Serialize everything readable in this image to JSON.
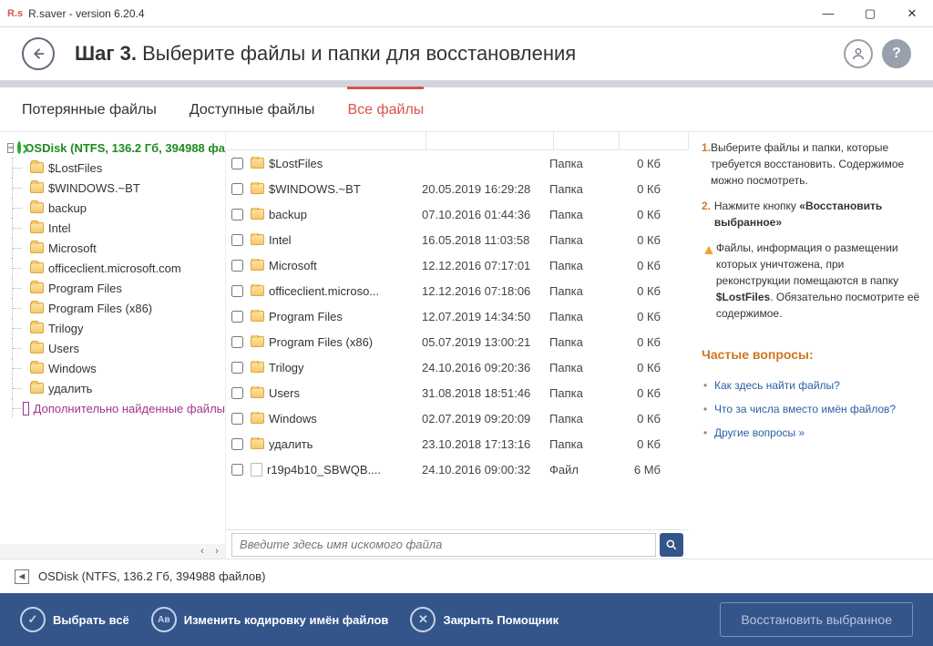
{
  "titlebar": {
    "app_icon": "R.s",
    "title": "R.saver - version 6.20.4"
  },
  "header": {
    "step_prefix": "Шаг 3.",
    "step_text": "Выберите файлы и папки для восстановления"
  },
  "tabs": {
    "lost": "Потерянные файлы",
    "available": "Доступные файлы",
    "all": "Все файлы"
  },
  "tree": {
    "root": "OSDisk (NTFS, 136.2 Гб, 394988 фа",
    "items": [
      "$LostFiles",
      "$WINDOWS.~BT",
      "backup",
      "Intel",
      "Microsoft",
      "officeclient.microsoft.com",
      "Program Files",
      "Program Files (x86)",
      "Trilogy",
      "Users",
      "Windows",
      "удалить"
    ],
    "extra": "Дополнительно найденные файлы"
  },
  "files": [
    {
      "name": "$LostFiles",
      "date": "",
      "type": "Папка",
      "size": "0 Кб"
    },
    {
      "name": "$WINDOWS.~BT",
      "date": "20.05.2019 16:29:28",
      "type": "Папка",
      "size": "0 Кб"
    },
    {
      "name": "backup",
      "date": "07.10.2016 01:44:36",
      "type": "Папка",
      "size": "0 Кб"
    },
    {
      "name": "Intel",
      "date": "16.05.2018 11:03:58",
      "type": "Папка",
      "size": "0 Кб"
    },
    {
      "name": "Microsoft",
      "date": "12.12.2016 07:17:01",
      "type": "Папка",
      "size": "0 Кб"
    },
    {
      "name": "officeclient.microso...",
      "date": "12.12.2016 07:18:06",
      "type": "Папка",
      "size": "0 Кб"
    },
    {
      "name": "Program Files",
      "date": "12.07.2019 14:34:50",
      "type": "Папка",
      "size": "0 Кб"
    },
    {
      "name": "Program Files (x86)",
      "date": "05.07.2019 13:00:21",
      "type": "Папка",
      "size": "0 Кб"
    },
    {
      "name": "Trilogy",
      "date": "24.10.2016 09:20:36",
      "type": "Папка",
      "size": "0 Кб"
    },
    {
      "name": "Users",
      "date": "31.08.2018 18:51:46",
      "type": "Папка",
      "size": "0 Кб"
    },
    {
      "name": "Windows",
      "date": "02.07.2019 09:20:09",
      "type": "Папка",
      "size": "0 Кб"
    },
    {
      "name": "удалить",
      "date": "23.10.2018 17:13:16",
      "type": "Папка",
      "size": "0 Кб"
    },
    {
      "name": "r19p4b10_SBWQB....",
      "date": "24.10.2016 09:00:32",
      "type": "Файл",
      "size": "6 Мб",
      "is_file": true
    }
  ],
  "search": {
    "placeholder": "Введите здесь имя искомого файла"
  },
  "info": {
    "step1": "Выберите файлы и папки, которые требуется восстановить. Содержимое можно посмотреть.",
    "step2_a": "Нажмите кнопку ",
    "step2_b": "«Восстановить выбранное»",
    "warn_a": "Файлы, информация о размещении которых уничтожена, при реконструкции помещаются в папку ",
    "warn_b": "$LostFiles",
    "warn_c": ". Обязательно посмотрите её содержимое."
  },
  "faq": {
    "title": "Частые вопросы:",
    "q1": "Как здесь найти файлы?",
    "q2": "Что за числа вместо имён файлов?",
    "q3": "Другие вопросы »"
  },
  "breadcrumb": "OSDisk (NTFS, 136.2 Гб, 394988 файлов)",
  "footer": {
    "select_all": "Выбрать всё",
    "encoding": "Изменить кодировку имён файлов",
    "close_helper": "Закрыть Помощник",
    "recover": "Восстановить выбранное"
  }
}
